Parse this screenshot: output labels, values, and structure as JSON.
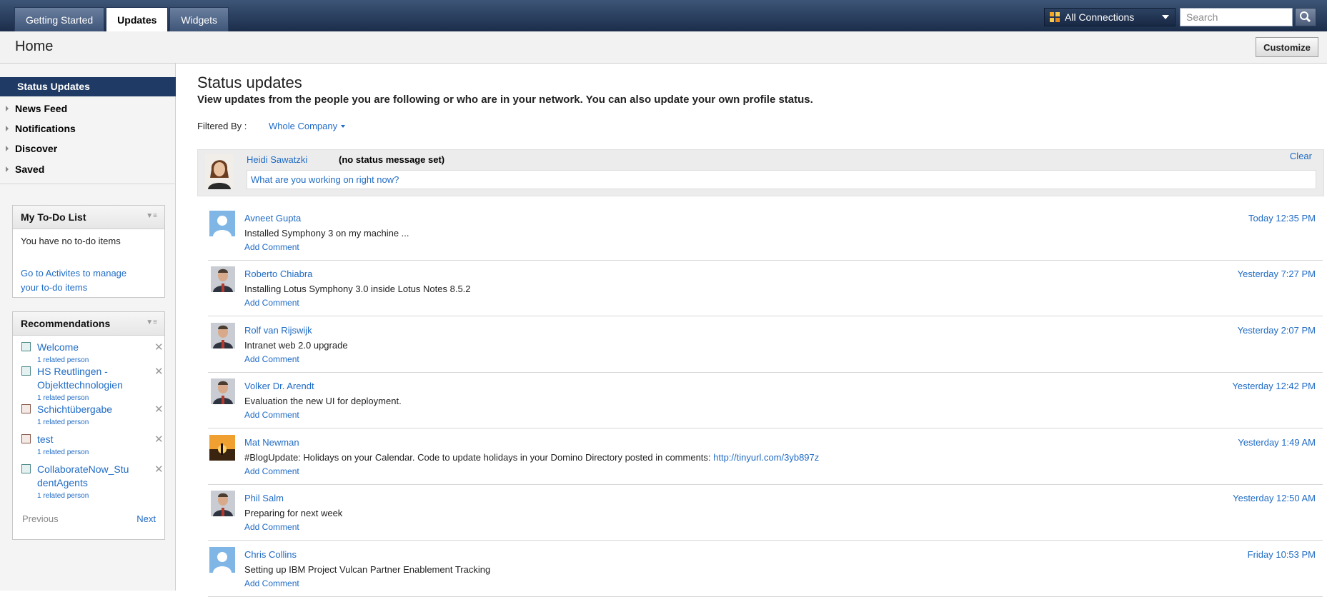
{
  "topnav": {
    "tabs": [
      {
        "label": "Getting Started",
        "active": false
      },
      {
        "label": "Updates",
        "active": true
      },
      {
        "label": "Widgets",
        "active": false
      }
    ],
    "connections_label": "All Connections",
    "search_placeholder": "Search"
  },
  "header": {
    "title": "Home",
    "customize_label": "Customize"
  },
  "sidebar": {
    "active_item": "Status Updates",
    "items": [
      "News Feed",
      "Notifications",
      "Discover",
      "Saved"
    ],
    "todo": {
      "title": "My To-Do List",
      "empty_text": "You have no to-do items",
      "link_line1": "Go to Activites to manage",
      "link_line2": "your to-do items"
    },
    "recommendations": {
      "title": "Recommendations",
      "items": [
        {
          "line1": "Welcome",
          "line2": "",
          "sub": "1 related person"
        },
        {
          "line1": "HS Reutlingen -",
          "line2": "Objekttechnologien",
          "sub": "1 related person"
        },
        {
          "line1": "Schichtübergabe",
          "line2": "",
          "sub": "1 related person"
        },
        {
          "line1": "test",
          "line2": "",
          "sub": "1 related person"
        },
        {
          "line1": "CollaborateNow_Stu",
          "line2": "dentAgents",
          "sub": "1 related person"
        }
      ],
      "prev_label": "Previous",
      "next_label": "Next"
    }
  },
  "main": {
    "title": "Status updates",
    "subtitle": "View updates from the people you are following or who are in your network. You can also update your own profile status.",
    "filter_label": "Filtered By :",
    "filter_value": "Whole Company",
    "my_status": {
      "name": "Heidi Sawatzki",
      "message": "(no status message set)",
      "clear_label": "Clear",
      "input_placeholder": "What are you working on right now?"
    },
    "comment_label": "Add Comment",
    "entries": [
      {
        "name": "Avneet Gupta",
        "text": "Installed Symphony 3 on my machine ...",
        "link": "",
        "time": "Today 12:35 PM",
        "avatar": "placeholder"
      },
      {
        "name": "Roberto Chiabra",
        "text": "Installing Lotus Symphony 3.0 inside Lotus Notes 8.5.2",
        "link": "",
        "time": "Yesterday 7:27 PM",
        "avatar": "photo"
      },
      {
        "name": "Rolf van Rijswijk",
        "text": "Intranet web 2.0 upgrade",
        "link": "",
        "time": "Yesterday 2:07 PM",
        "avatar": "photo"
      },
      {
        "name": "Volker Dr. Arendt",
        "text": "Evaluation the new UI for deployment.",
        "link": "",
        "time": "Yesterday 12:42 PM",
        "avatar": "photo"
      },
      {
        "name": "Mat Newman",
        "text": "#BlogUpdate: Holidays on your Calendar. Code to update holidays in your Domino Directory posted in comments: ",
        "link": "http://tinyurl.com/3yb897z",
        "time": "Yesterday 1:49 AM",
        "avatar": "sunset"
      },
      {
        "name": "Phil Salm",
        "text": "Preparing for next week",
        "link": "",
        "time": "Yesterday 12:50 AM",
        "avatar": "photo"
      },
      {
        "name": "Chris Collins",
        "text": "Setting up IBM Project Vulcan Partner Enablement Tracking",
        "link": "",
        "time": "Friday 10:53 PM",
        "avatar": "placeholder"
      }
    ]
  },
  "colors": {
    "nav_dark": "#1b2d4a",
    "link": "#1f6bc5",
    "active_nav": "#1f3a64"
  }
}
